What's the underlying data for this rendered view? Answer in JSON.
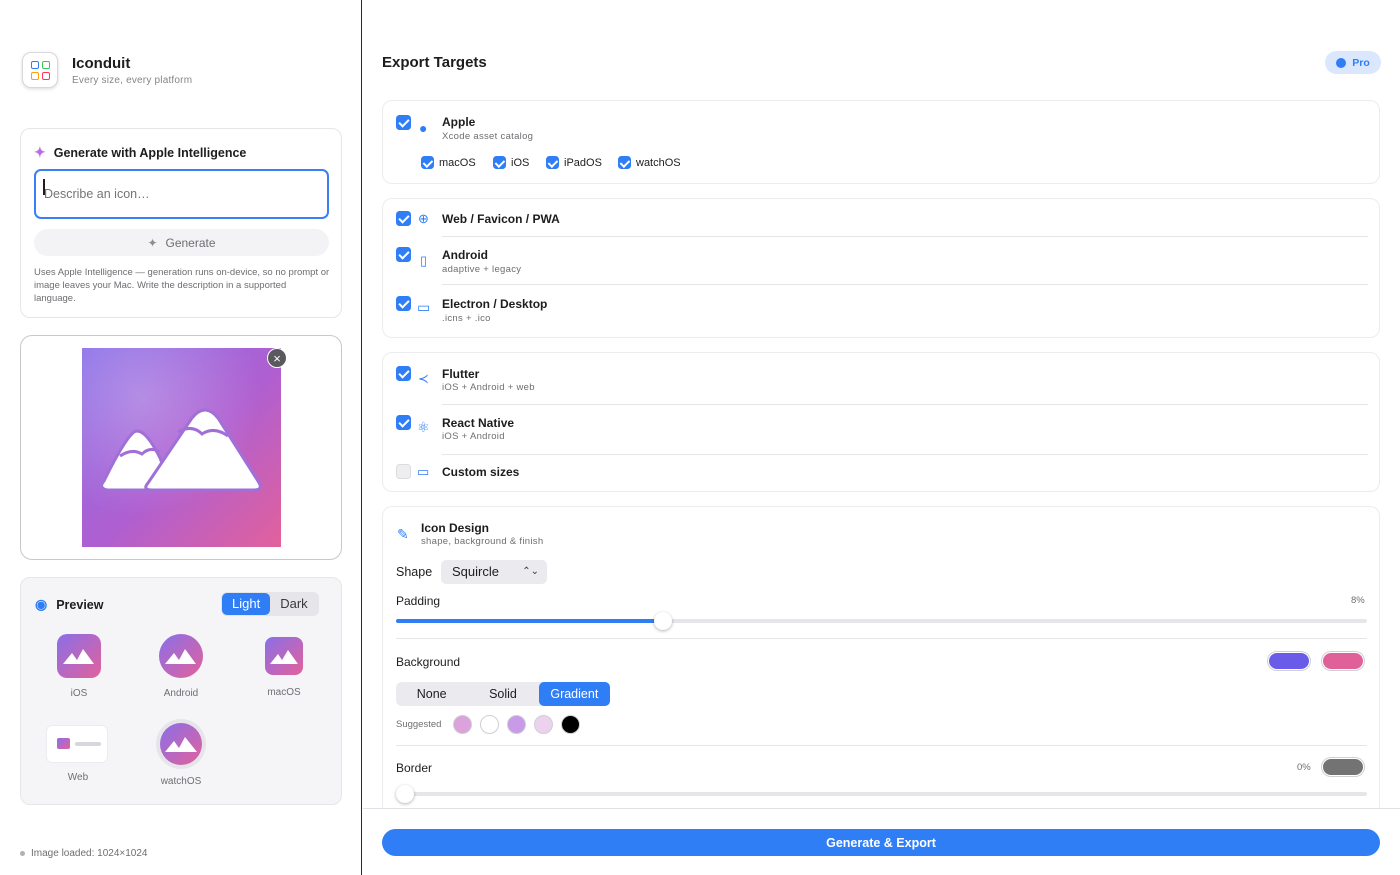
{
  "app": {
    "name": "Iconduit",
    "tagline": "Every size, every platform"
  },
  "generate": {
    "title": "Generate with Apple Intelligence",
    "placeholder": "Describe an icon…",
    "button": "Generate",
    "note": "Uses Apple Intelligence — generation runs on-device, so no prompt or image leaves your Mac. Write the description in a supported language."
  },
  "preview": {
    "title": "Preview",
    "modes": [
      "Light",
      "Dark"
    ],
    "selected_mode": "Light",
    "items": [
      "iOS",
      "Android",
      "macOS",
      "Web",
      "watchOS"
    ]
  },
  "status": "Image loaded: 1024×1024",
  "main": {
    "title": "Export Targets",
    "badge": "Pro",
    "apple": {
      "title": "Apple",
      "subtitle": "Xcode asset catalog",
      "checked": true,
      "platforms": [
        {
          "label": "macOS",
          "checked": true
        },
        {
          "label": "iOS",
          "checked": true
        },
        {
          "label": "iPadOS",
          "checked": true
        },
        {
          "label": "watchOS",
          "checked": true
        }
      ]
    },
    "group2": [
      {
        "title": "Web / Favicon / PWA",
        "subtitle": "",
        "checked": true,
        "icon": "globe-icon"
      },
      {
        "title": "Android",
        "subtitle": "adaptive + legacy",
        "checked": true,
        "icon": "phone-icon"
      },
      {
        "title": "Electron / Desktop",
        "subtitle": ".icns + .ico",
        "checked": true,
        "icon": "desktop-icon"
      }
    ],
    "group3": [
      {
        "title": "Flutter",
        "subtitle": "iOS + Android + web",
        "checked": true,
        "icon": "flutter-icon"
      },
      {
        "title": "React Native",
        "subtitle": "iOS + Android",
        "checked": true,
        "icon": "atom-icon"
      },
      {
        "title": "Custom sizes",
        "subtitle": "",
        "checked": false,
        "icon": "ruler-icon"
      }
    ],
    "design": {
      "title": "Icon Design",
      "subtitle": "shape, background & finish",
      "shape_label": "Shape",
      "shape_value": "Squircle",
      "padding_label": "Padding",
      "padding_value": "8%",
      "padding_fraction": 0.27,
      "background_label": "Background",
      "background_modes": [
        "None",
        "Solid",
        "Gradient"
      ],
      "background_selected": "Gradient",
      "gradient_colors": [
        "#6a5ce8",
        "#e0609a"
      ],
      "suggested_label": "Suggested",
      "suggested_colors": [
        "#dba2dc",
        "#ffffff",
        "#c99ae8",
        "#ecd2ee",
        "#000000"
      ],
      "border_label": "Border",
      "border_value": "0%",
      "border_color": "#737373"
    },
    "export_button": "Generate & Export"
  },
  "colors": {
    "accent": "#2f7ef6"
  }
}
